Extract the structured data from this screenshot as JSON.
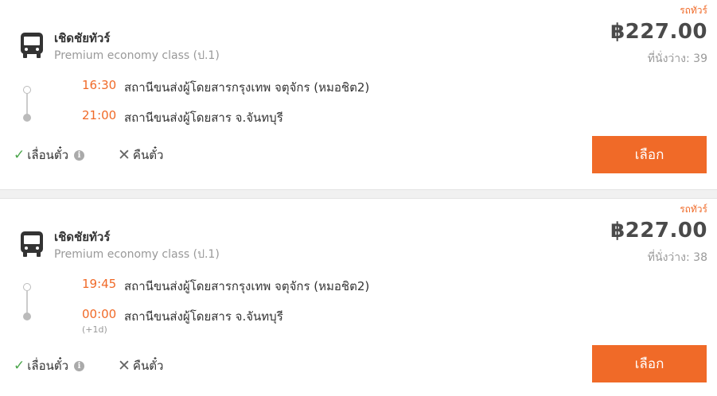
{
  "trips": [
    {
      "operator": "เชิดชัยทัวร์",
      "bus_class": "Premium economy class (ป.1)",
      "tag": "รถทัวร์",
      "price": "฿227.00",
      "seats_label": "ที่นั่งว่าง:",
      "seats_count": "39",
      "depart_time": "16:30",
      "depart_station": "สถานีขนส่งผู้โดยสารกรุงเทพ จตุจักร (หมอชิต2)",
      "arrive_time": "21:00",
      "arrive_station": "สถานีขนส่งผู้โดยสาร จ.จันทบุรี",
      "day_offset": "",
      "reschedule_label": "เลื่อนตั๋ว",
      "refund_label": "คืนตั๋ว",
      "select_label": "เลือก"
    },
    {
      "operator": "เชิดชัยทัวร์",
      "bus_class": "Premium economy class (ป.1)",
      "tag": "รถทัวร์",
      "price": "฿227.00",
      "seats_label": "ที่นั่งว่าง:",
      "seats_count": "38",
      "depart_time": "19:45",
      "depart_station": "สถานีขนส่งผู้โดยสารกรุงเทพ จตุจักร (หมอชิต2)",
      "arrive_time": "00:00",
      "arrive_station": "สถานีขนส่งผู้โดยสาร จ.จันทบุรี",
      "day_offset": "(+1d)",
      "reschedule_label": "เลื่อนตั๋ว",
      "refund_label": "คืนตั๋ว",
      "select_label": "เลือก"
    }
  ],
  "icons": {
    "bus": "bus-icon",
    "reschedule_allowed": "checkmark-icon",
    "refund_not_allowed": "cross-icon",
    "info": "info-icon"
  },
  "colors": {
    "accent": "#f06a28",
    "allowed": "#4ca64c",
    "price": "#4a4a4a",
    "muted": "#999999"
  }
}
